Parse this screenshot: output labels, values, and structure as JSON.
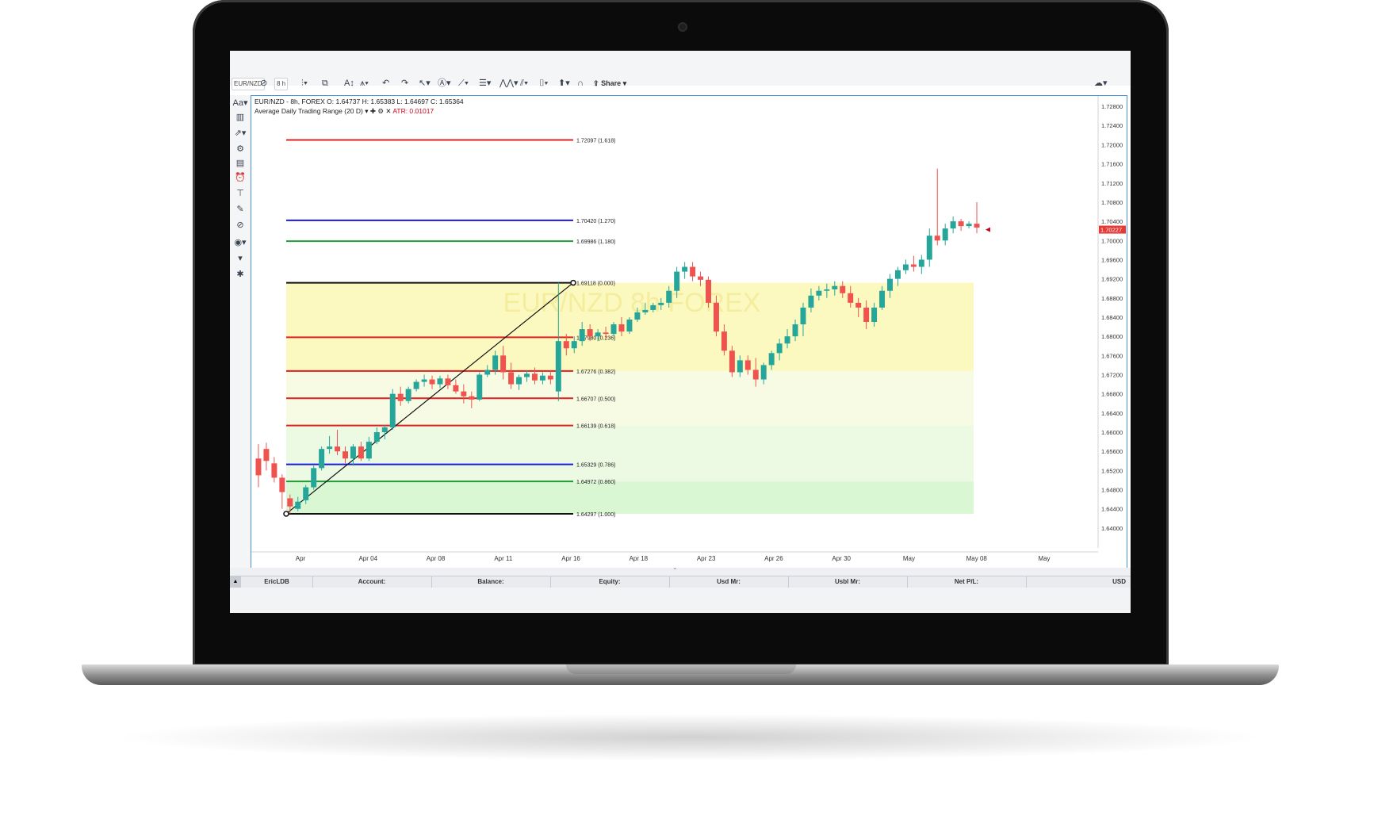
{
  "toolbar": {
    "symbol": "EUR/NZD",
    "interval": "8 h",
    "share_label": "Share"
  },
  "chart": {
    "header": "EUR/NZD - 8h, FOREX O: 1.64737 H: 1.65383 L: 1.64697 C: 1.65364",
    "indicator_name": "Average Daily Trading Range (20 D)",
    "indicator_value": "ATR: 0.01017",
    "watermark": "EUR/NZD 8h FOREX",
    "current_price": "1.70227"
  },
  "account_bar": {
    "user": "EricLDB",
    "account": "Account:",
    "balance": "Balance:",
    "equity": "Equity:",
    "usd_mr": "Usd Mr:",
    "usbl_mr": "Usbl Mr:",
    "net_pl": "Net P/L:",
    "currency": "USD"
  },
  "colors": {
    "up": "#26a69a",
    "down": "#ef5350",
    "fib_red": "#e02020",
    "fib_blue": "#1a1adc",
    "fib_green": "#1f9d35",
    "fib_black": "#111111",
    "frame_border": "#4a90d9"
  },
  "chart_data": {
    "type": "candlestick",
    "price_axis": {
      "ticks": [
        "1.72800",
        "1.72400",
        "1.72000",
        "1.71600",
        "1.71200",
        "1.70800",
        "1.70400",
        "1.70000",
        "1.69600",
        "1.69200",
        "1.68800",
        "1.68400",
        "1.68000",
        "1.67600",
        "1.67200",
        "1.66800",
        "1.66400",
        "1.66000",
        "1.65600",
        "1.65200",
        "1.64800",
        "1.64400",
        "1.64000"
      ],
      "ylim": [
        1.6375,
        1.7295
      ]
    },
    "time_axis": {
      "labels": [
        "Apr",
        "Apr 04",
        "Apr 08",
        "Apr 11",
        "Apr 16",
        "Apr 18",
        "Apr 23",
        "Apr 26",
        "Apr 30",
        "May",
        "May 08",
        "May"
      ]
    },
    "fib_levels": [
      {
        "price": 1.72097,
        "label": "1.72097 (1.618)",
        "color": "red"
      },
      {
        "price": 1.7042,
        "label": "1.70420 (1.270)",
        "color": "blue"
      },
      {
        "price": 1.69986,
        "label": "1.69986 (1.180)",
        "color": "green"
      },
      {
        "price": 1.69118,
        "label": "1.69118 (0.000)",
        "color": "black"
      },
      {
        "price": 1.6798,
        "label": "1.67980 (0.236)",
        "color": "red"
      },
      {
        "price": 1.67276,
        "label": "1.67276 (0.382)",
        "color": "red"
      },
      {
        "price": 1.66707,
        "label": "1.66707 (0.500)",
        "color": "red"
      },
      {
        "price": 1.66139,
        "label": "1.66139 (0.618)",
        "color": "red"
      },
      {
        "price": 1.65329,
        "label": "1.65329 (0.786)",
        "color": "blue"
      },
      {
        "price": 1.64972,
        "label": "1.64972 (0.860)",
        "color": "green"
      },
      {
        "price": 1.64297,
        "label": "1.64297 (1.000)",
        "color": "black"
      }
    ],
    "candles": [
      [
        1.6545,
        1.6575,
        1.6485,
        1.651
      ],
      [
        1.6565,
        1.6578,
        1.652,
        1.654
      ],
      [
        1.6535,
        1.6548,
        1.6495,
        1.6505
      ],
      [
        1.6505,
        1.6512,
        1.644,
        1.6475
      ],
      [
        1.6462,
        1.647,
        1.643,
        1.6445
      ],
      [
        1.644,
        1.6465,
        1.6435,
        1.6455
      ],
      [
        1.6458,
        1.649,
        1.645,
        1.6485
      ],
      [
        1.6485,
        1.653,
        1.648,
        1.6525
      ],
      [
        1.6525,
        1.657,
        1.652,
        1.6565
      ],
      [
        1.6565,
        1.6592,
        1.6555,
        1.657
      ],
      [
        1.657,
        1.6605,
        1.6552,
        1.656
      ],
      [
        1.656,
        1.657,
        1.6535,
        1.6545
      ],
      [
        1.6545,
        1.6575,
        1.653,
        1.657
      ],
      [
        1.657,
        1.658,
        1.654,
        1.6545
      ],
      [
        1.6545,
        1.659,
        1.654,
        1.658
      ],
      [
        1.658,
        1.661,
        1.6575,
        1.66
      ],
      [
        1.66,
        1.6615,
        1.6585,
        1.661
      ],
      [
        1.661,
        1.669,
        1.6605,
        1.668
      ],
      [
        1.668,
        1.6695,
        1.6655,
        1.6665
      ],
      [
        1.6665,
        1.6695,
        1.666,
        1.669
      ],
      [
        1.669,
        1.671,
        1.6685,
        1.6705
      ],
      [
        1.6705,
        1.672,
        1.6695,
        1.671
      ],
      [
        1.671,
        1.6718,
        1.669,
        1.67
      ],
      [
        1.67,
        1.6718,
        1.6692,
        1.6712
      ],
      [
        1.6712,
        1.672,
        1.669,
        1.6698
      ],
      [
        1.6698,
        1.671,
        1.668,
        1.6685
      ],
      [
        1.6685,
        1.67,
        1.666,
        1.6675
      ],
      [
        1.6675,
        1.6685,
        1.665,
        1.6668
      ],
      [
        1.6668,
        1.6725,
        1.6665,
        1.672
      ],
      [
        1.672,
        1.674,
        1.6715,
        1.673
      ],
      [
        1.673,
        1.677,
        1.672,
        1.676
      ],
      [
        1.676,
        1.678,
        1.671,
        1.6725
      ],
      [
        1.6725,
        1.6745,
        1.669,
        1.67
      ],
      [
        1.67,
        1.672,
        1.6688,
        1.6715
      ],
      [
        1.6715,
        1.673,
        1.6705,
        1.6722
      ],
      [
        1.6722,
        1.6735,
        1.67,
        1.6708
      ],
      [
        1.6708,
        1.6725,
        1.67,
        1.6718
      ],
      [
        1.6718,
        1.6728,
        1.67,
        1.671
      ],
      [
        1.6685,
        1.6912,
        1.6665,
        1.679
      ],
      [
        1.679,
        1.6805,
        1.676,
        1.6775
      ],
      [
        1.6775,
        1.68,
        1.6765,
        1.679
      ],
      [
        1.679,
        1.683,
        1.678,
        1.6815
      ],
      [
        1.6815,
        1.6825,
        1.679,
        1.68
      ],
      [
        1.68,
        1.6815,
        1.679,
        1.6808
      ],
      [
        1.6808,
        1.682,
        1.6795,
        1.6805
      ],
      [
        1.6805,
        1.683,
        1.68,
        1.6825
      ],
      [
        1.6825,
        1.684,
        1.68,
        1.681
      ],
      [
        1.681,
        1.684,
        1.6805,
        1.6835
      ],
      [
        1.6835,
        1.686,
        1.683,
        1.685
      ],
      [
        1.685,
        1.687,
        1.6845,
        1.6855
      ],
      [
        1.6855,
        1.687,
        1.685,
        1.6865
      ],
      [
        1.6865,
        1.688,
        1.6855,
        1.687
      ],
      [
        1.687,
        1.6905,
        1.686,
        1.6895
      ],
      [
        1.6895,
        1.6945,
        1.688,
        1.6935
      ],
      [
        1.6935,
        1.6955,
        1.692,
        1.6945
      ],
      [
        1.6945,
        1.6955,
        1.6915,
        1.6925
      ],
      [
        1.6925,
        1.6935,
        1.6905,
        1.6918
      ],
      [
        1.6918,
        1.6925,
        1.686,
        1.687
      ],
      [
        1.687,
        1.6885,
        1.68,
        1.681
      ],
      [
        1.681,
        1.6825,
        1.676,
        1.677
      ],
      [
        1.677,
        1.678,
        1.6715,
        1.6725
      ],
      [
        1.6725,
        1.676,
        1.6715,
        1.675
      ],
      [
        1.675,
        1.676,
        1.672,
        1.673
      ],
      [
        1.673,
        1.6755,
        1.6695,
        1.671
      ],
      [
        1.671,
        1.6745,
        1.67,
        1.674
      ],
      [
        1.674,
        1.677,
        1.673,
        1.6765
      ],
      [
        1.6765,
        1.6795,
        1.675,
        1.6785
      ],
      [
        1.6785,
        1.6815,
        1.6775,
        1.68
      ],
      [
        1.68,
        1.6835,
        1.679,
        1.6825
      ],
      [
        1.6825,
        1.687,
        1.68,
        1.686
      ],
      [
        1.686,
        1.69,
        1.685,
        1.6885
      ],
      [
        1.6885,
        1.6905,
        1.6875,
        1.6895
      ],
      [
        1.6895,
        1.691,
        1.688,
        1.6898
      ],
      [
        1.6898,
        1.6915,
        1.6885,
        1.6905
      ],
      [
        1.6905,
        1.6915,
        1.688,
        1.689
      ],
      [
        1.689,
        1.6905,
        1.686,
        1.687
      ],
      [
        1.687,
        1.688,
        1.684,
        1.686
      ],
      [
        1.686,
        1.6875,
        1.6815,
        1.683
      ],
      [
        1.683,
        1.687,
        1.682,
        1.686
      ],
      [
        1.686,
        1.6905,
        1.6855,
        1.6895
      ],
      [
        1.6895,
        1.693,
        1.688,
        1.692
      ],
      [
        1.692,
        1.6945,
        1.6905,
        1.6938
      ],
      [
        1.6938,
        1.696,
        1.693,
        1.695
      ],
      [
        1.695,
        1.6968,
        1.6935,
        1.6945
      ],
      [
        1.6945,
        1.697,
        1.693,
        1.696
      ],
      [
        1.696,
        1.7025,
        1.6945,
        1.701
      ],
      [
        1.701,
        1.715,
        1.699,
        1.7
      ],
      [
        1.7,
        1.7035,
        1.699,
        1.7025
      ],
      [
        1.7025,
        1.705,
        1.7015,
        1.704
      ],
      [
        1.704,
        1.7045,
        1.702,
        1.703
      ],
      [
        1.703,
        1.704,
        1.7025,
        1.7035
      ],
      [
        1.7035,
        1.708,
        1.7015,
        1.7027
      ]
    ]
  }
}
